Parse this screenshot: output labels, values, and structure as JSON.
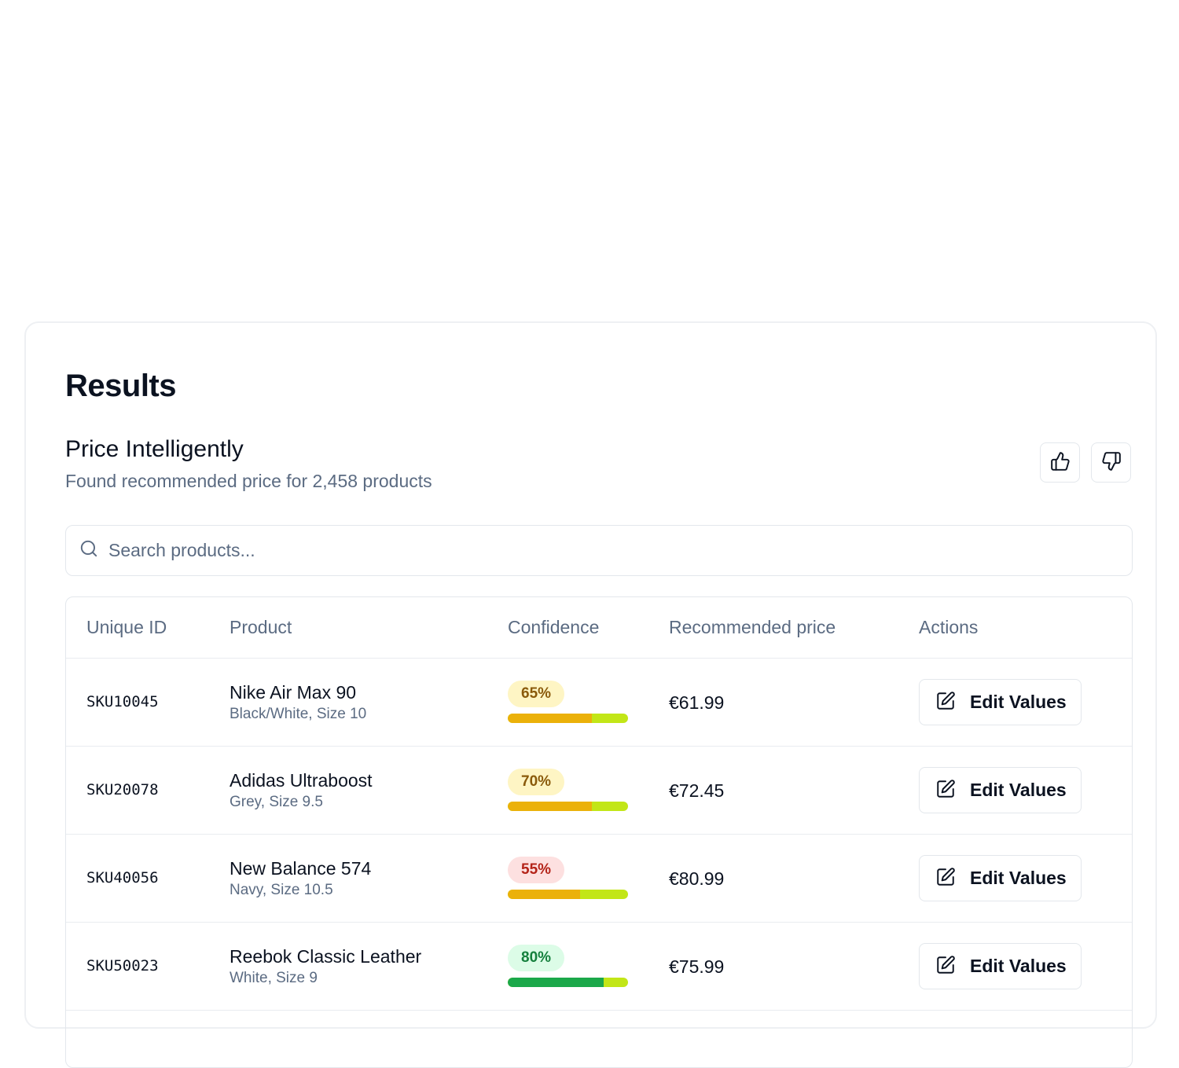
{
  "results": {
    "title": "Results",
    "subtitle": "Price Intelligently",
    "summary": "Found recommended price for 2,458 products"
  },
  "feedback": {
    "up_icon": "thumbs-up-icon",
    "down_icon": "thumbs-down-icon"
  },
  "search": {
    "placeholder": "Search products...",
    "value": ""
  },
  "table": {
    "columns": [
      "Unique ID",
      "Product",
      "Confidence",
      "Recommended price",
      "Actions"
    ],
    "rows": [
      {
        "id": "SKU10045",
        "name": "Nike Air Max 90",
        "variant": "Black/White, Size 10",
        "confidence": "65%",
        "confidence_value": 0.7,
        "level": "medium",
        "price": "€61.99",
        "action": "Edit Values"
      },
      {
        "id": "SKU20078",
        "name": "Adidas Ultraboost",
        "variant": "Grey, Size 9.5",
        "confidence": "70%",
        "confidence_value": 0.7,
        "level": "medium",
        "price": "€72.45",
        "action": "Edit Values"
      },
      {
        "id": "SKU40056",
        "name": "New Balance 574",
        "variant": "Navy, Size 10.5",
        "confidence": "55%",
        "confidence_value": 0.6,
        "level": "low",
        "price": "€80.99",
        "action": "Edit Values"
      },
      {
        "id": "SKU50023",
        "name": "Reebok Classic Leather",
        "variant": "White, Size 9",
        "confidence": "80%",
        "confidence_value": 0.8,
        "level": "high",
        "price": "€75.99",
        "action": "Edit Values"
      }
    ]
  },
  "colors": {
    "badge_medium_bg": "#fef5c4",
    "badge_medium_text": "#8a5a0b",
    "badge_low_bg": "#fde0e0",
    "badge_low_text": "#b42318",
    "badge_high_bg": "#dcfce7",
    "badge_high_text": "#15803d",
    "bar_medium": "#ebb10a",
    "bar_low": "#ebb10a",
    "bar_high": "#1ba84a",
    "bar_track": "#c2e617"
  }
}
